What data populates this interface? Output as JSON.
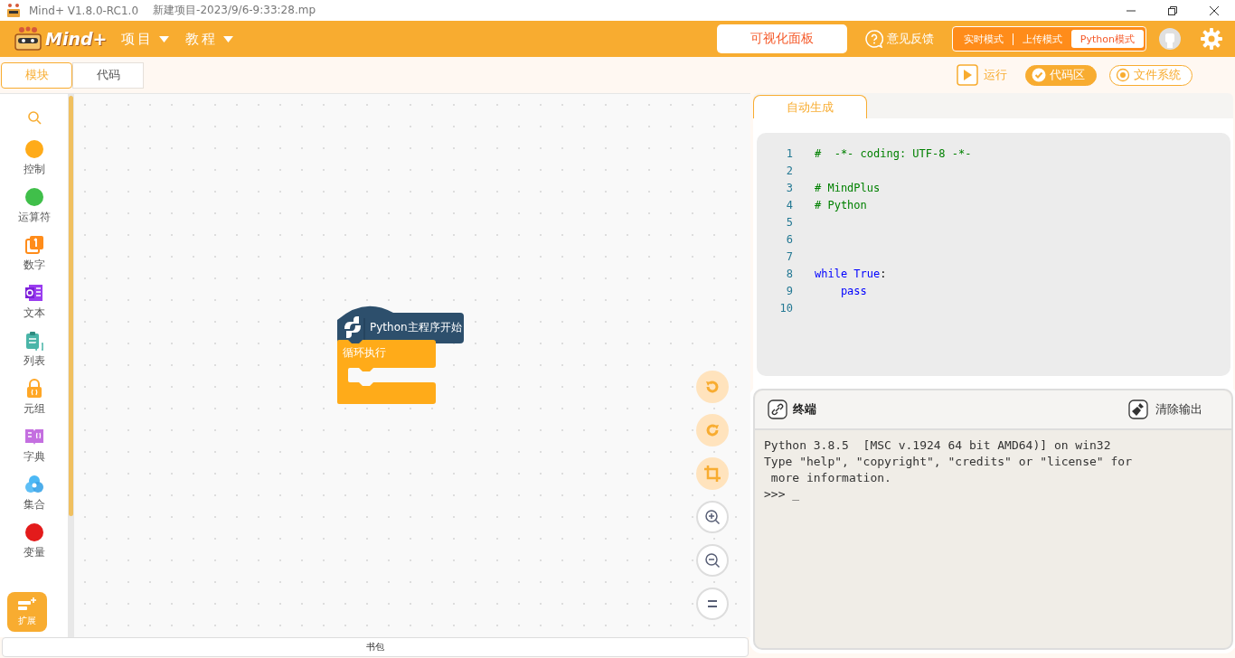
{
  "window": {
    "title": "Mind+ V1.8.0-RC1.0",
    "file": "新建项目-2023/9/6-9:33:28.mp"
  },
  "header": {
    "logo": "Mind+",
    "menus": [
      {
        "label": "项目"
      },
      {
        "label": "教程"
      }
    ],
    "panel_button": "可视化面板",
    "feedback": "意见反馈",
    "modes": [
      {
        "label": "实时模式",
        "selected": false
      },
      {
        "label": "上传模式",
        "selected": false
      },
      {
        "label": "Python模式",
        "selected": true
      }
    ]
  },
  "toolbar": {
    "tabs": [
      {
        "label": "模块",
        "selected": true
      },
      {
        "label": "代码",
        "selected": false
      }
    ],
    "run": "运行",
    "toggles": [
      {
        "label": "代码区",
        "selected": true
      },
      {
        "label": "文件系统",
        "selected": false
      }
    ]
  },
  "categories": [
    {
      "label": "控制",
      "kind": "dot",
      "color": "#ffab19"
    },
    {
      "label": "运算符",
      "kind": "dot",
      "color": "#40bf4a"
    },
    {
      "label": "数字",
      "kind": "number"
    },
    {
      "label": "文本",
      "kind": "text"
    },
    {
      "label": "列表",
      "kind": "list"
    },
    {
      "label": "元组",
      "kind": "tuple"
    },
    {
      "label": "字典",
      "kind": "dict"
    },
    {
      "label": "集合",
      "kind": "set"
    },
    {
      "label": "变量",
      "kind": "dot",
      "color": "#e31b1b"
    }
  ],
  "extension": "扩展",
  "blocks": {
    "hat": "Python主程序开始",
    "loop": "循环执行"
  },
  "backpack": "书包",
  "code_tab": "自动生成",
  "code": [
    {
      "number": "1",
      "tokens": [
        {
          "text": "#  -*- coding: UTF-8 -*-",
          "kind": "comment"
        }
      ]
    },
    {
      "number": "2"
    },
    {
      "number": "3",
      "tokens": [
        {
          "text": "# MindPlus",
          "kind": "comment"
        }
      ]
    },
    {
      "number": "4",
      "tokens": [
        {
          "text": "# Python",
          "kind": "comment"
        }
      ]
    },
    {
      "number": "5"
    },
    {
      "number": "6"
    },
    {
      "number": "7"
    },
    {
      "number": "8",
      "tokens": [
        {
          "text": "while",
          "kind": "keyword"
        },
        {
          "text": "True",
          "kind": "constant",
          "space_before": true
        },
        {
          "text": ":",
          "kind": "plain"
        }
      ]
    },
    {
      "number": "9",
      "indented": true,
      "tokens": [
        {
          "text": "pass",
          "kind": "keyword"
        }
      ]
    },
    {
      "number": "10"
    }
  ],
  "terminal": {
    "title": "终端",
    "clear": "清除输出",
    "lines": [
      "Python 3.8.5  [MSC v.1924 64 bit AMD64)] on win32",
      "Type \"help\", \"copyright\", \"credits\" or \"license\" for",
      " more information.",
      ">>> _"
    ]
  }
}
